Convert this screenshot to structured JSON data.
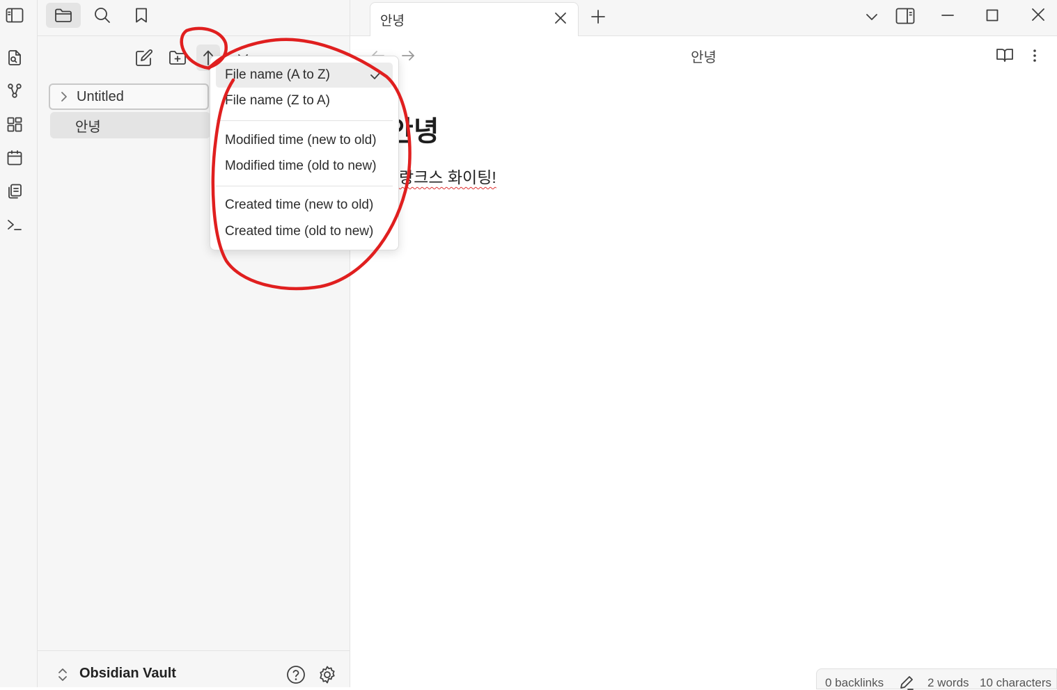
{
  "ribbon": {
    "items": [
      {
        "icon": "open-quick-switcher-icon"
      },
      {
        "icon": "graph-view-icon"
      },
      {
        "icon": "canvas-icon"
      },
      {
        "icon": "daily-note-calendar-icon"
      },
      {
        "icon": "templates-icon"
      },
      {
        "icon": "command-palette-icon"
      }
    ]
  },
  "sidebar": {
    "tabs": [
      {
        "icon": "folder-icon",
        "active": true
      },
      {
        "icon": "search-icon",
        "active": false
      },
      {
        "icon": "bookmark-icon",
        "active": false
      }
    ],
    "tree": {
      "folder": {
        "label": "Untitled"
      },
      "file": {
        "label": "안녕"
      }
    },
    "vault": {
      "name": "Obsidian Vault"
    }
  },
  "sort_menu": {
    "groups": [
      [
        {
          "label": "File name (A to Z)",
          "checked": true
        },
        {
          "label": "File name (Z to A)",
          "checked": false
        }
      ],
      [
        {
          "label": "Modified time (new to old)",
          "checked": false
        },
        {
          "label": "Modified time (old to new)",
          "checked": false
        }
      ],
      [
        {
          "label": "Created time (new to old)",
          "checked": false
        },
        {
          "label": "Created time (old to new)",
          "checked": false
        }
      ]
    ]
  },
  "tabs": {
    "active": {
      "title": "안녕"
    }
  },
  "editor": {
    "view_title": "안녕",
    "heading": "안녕",
    "body_text": "랑크스 화이팅!"
  },
  "status_bar": {
    "backlinks": "0 backlinks",
    "words": "2 words",
    "characters": "10 characters"
  },
  "colors": {
    "annotation": "#e01f1f",
    "sidebar_bg": "#f6f6f6",
    "selected_bg": "#e4e4e4"
  }
}
